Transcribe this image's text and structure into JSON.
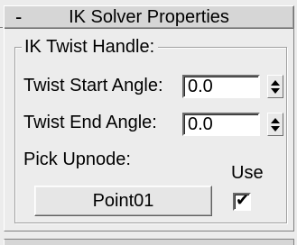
{
  "rollout": {
    "toggle": "-",
    "title": "IK Solver Properties"
  },
  "twist_handle": {
    "group_title": "IK Twist Handle:",
    "start_angle_label": "Twist Start Angle:",
    "start_angle_value": "0.0",
    "end_angle_label": "Twist End Angle:",
    "end_angle_value": "0.0"
  },
  "upnode": {
    "pick_label": "Pick Upnode:",
    "use_label": "Use",
    "button_label": "Point01",
    "use_checked": true,
    "check_glyph": "✔"
  },
  "icons": {
    "spinner": "spinner-up-down-icon",
    "checkbox": "checkmark-icon"
  },
  "colors": {
    "panel_bg": "#ececec",
    "header_bg": "#d6d6d6",
    "field_bg": "#ffffff"
  }
}
